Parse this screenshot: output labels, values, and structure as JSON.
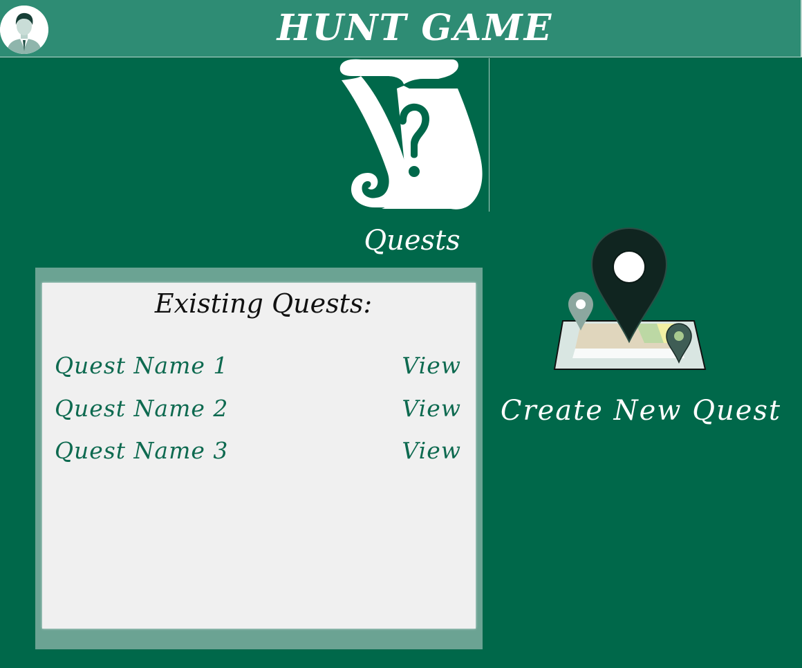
{
  "header": {
    "title": "HUNT GAME",
    "avatar_icon": "user-avatar-icon"
  },
  "quests": {
    "label": "Quests",
    "icon": "scroll-question-icon"
  },
  "existing_quests": {
    "title": "Existing Quests:",
    "items": [
      {
        "name": "Quest Name 1",
        "action": "View"
      },
      {
        "name": "Quest Name 2",
        "action": "View"
      },
      {
        "name": "Quest Name 3",
        "action": "View"
      }
    ]
  },
  "create_quest": {
    "label": "Create New Quest",
    "icon": "map-pin-icon"
  },
  "colors": {
    "background": "#00684a",
    "header": "#2e8c74",
    "panel_frame": "#6ba393",
    "panel": "#f0f0f0",
    "quest_text": "#0e6a50"
  }
}
